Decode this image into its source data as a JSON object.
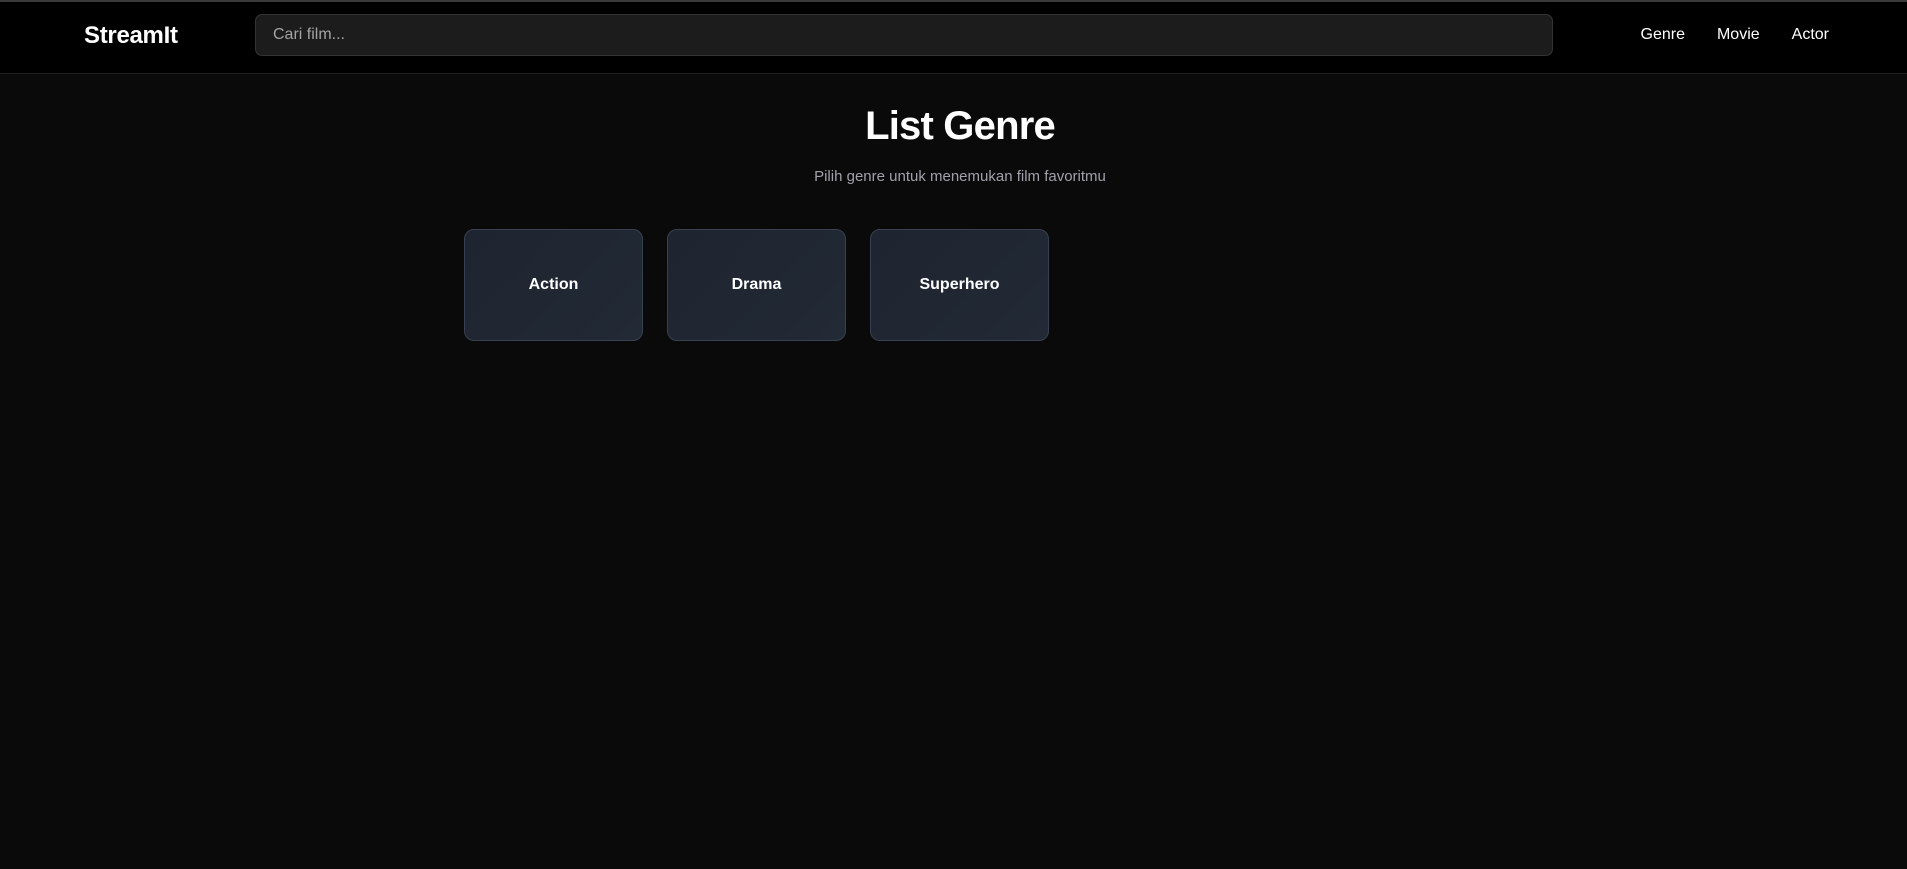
{
  "header": {
    "brand": "StreamIt",
    "search": {
      "placeholder": "Cari film...",
      "value": ""
    },
    "nav": [
      {
        "label": "Genre"
      },
      {
        "label": "Movie"
      },
      {
        "label": "Actor"
      }
    ]
  },
  "main": {
    "title": "List Genre",
    "subtitle": "Pilih genre untuk menemukan film favoritmu",
    "genres": [
      {
        "label": "Action"
      },
      {
        "label": "Drama"
      },
      {
        "label": "Superhero"
      }
    ]
  },
  "colors": {
    "background": "#0a0a0a",
    "navbar": "#000000",
    "card_background": "#1e2430",
    "card_border": "#374151",
    "subtitle_text": "#a1a1aa"
  }
}
